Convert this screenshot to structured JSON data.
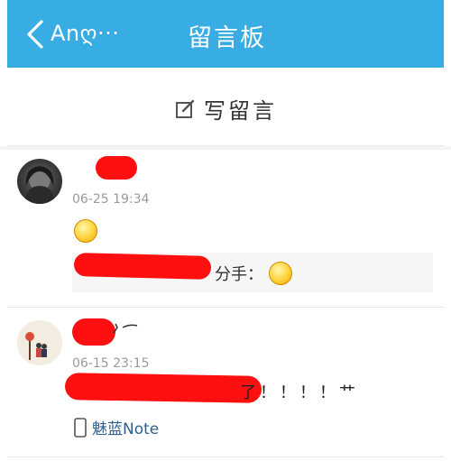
{
  "header": {
    "back_label": "Anღ···",
    "title": "留言板"
  },
  "write": {
    "label": "写留言"
  },
  "messages": [
    {
      "name": "",
      "time": "06-25 19:34",
      "quote_visible": "分手："
    },
    {
      "name": "",
      "time": "06-15 23:15",
      "content_visible": "了！！！！艹",
      "device": "魅蓝Note"
    }
  ],
  "colors": {
    "header_bg": "#38ade4",
    "redaction": "#ff0f0f",
    "timestamp": "#9a9a9a",
    "device_link": "#2f5f8d"
  },
  "icons": {
    "back": "chevron-left-icon",
    "write": "edit-icon",
    "device": "phone-icon",
    "emoji": "smile-emoji-icon"
  }
}
